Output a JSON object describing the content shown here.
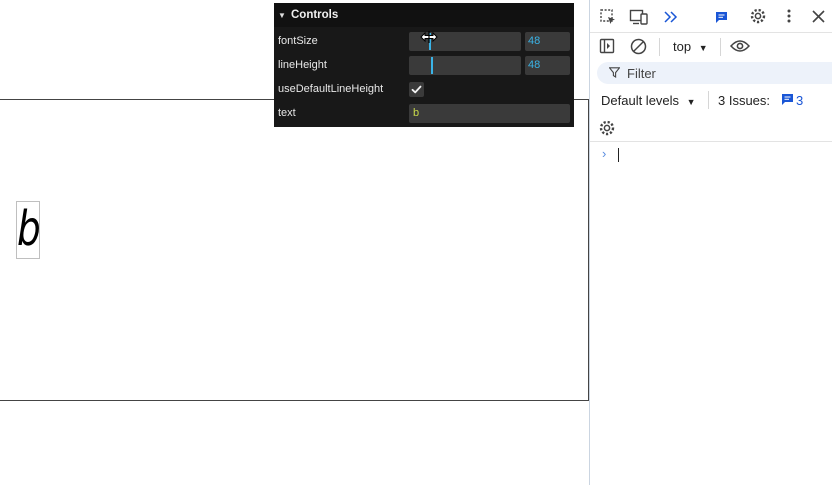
{
  "preview": {
    "glyph_text": "b"
  },
  "controls": {
    "title": "Controls",
    "font_size": {
      "label": "fontSize",
      "value": "48",
      "fraction": 0.18
    },
    "line_height": {
      "label": "lineHeight",
      "value": "48",
      "fraction": 0.2
    },
    "use_default_line_height": {
      "label": "useDefaultLineHeight",
      "checked": true
    },
    "text": {
      "label": "text",
      "value": "b"
    }
  },
  "devtools": {
    "context_select": "top",
    "filter_placeholder": "Filter",
    "levels_label": "Default levels",
    "issues_label": "3 Issues:",
    "issues_count": "3",
    "accent": "#1a56d6"
  }
}
